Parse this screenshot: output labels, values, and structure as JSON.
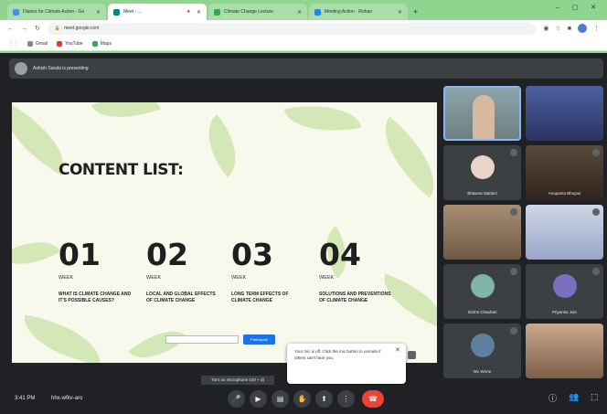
{
  "browser": {
    "tabs": [
      {
        "label": "Diaries for Climate Action - Go",
        "active": false
      },
      {
        "label": "Meet - ...",
        "active": true
      },
      {
        "label": "Climate Change Lecture",
        "active": false
      },
      {
        "label": "Meeting Action · Rohan",
        "active": false
      }
    ],
    "new_tab": "+",
    "window_controls": "– ▢ ✕",
    "url": "meet.google.com",
    "bookmarks": [
      "Gmail",
      "YouTube",
      "Maps"
    ]
  },
  "presenter_bar": {
    "text": "Ashish Sarala is presenting"
  },
  "slide": {
    "title": "CONTENT LIST:",
    "weeks": [
      {
        "num": "01",
        "label": "WEEK",
        "desc": "WHAT IS CLIMATE CHANGE AND IT'S POSSIBLE CAUSES?"
      },
      {
        "num": "02",
        "label": "WEEK",
        "desc": "LOCAL AND GLOBAL EFFECTS OF CLIMATE CHANGE"
      },
      {
        "num": "03",
        "label": "WEEK",
        "desc": "LONG TERM EFFECTS OF CLIMATE CHANGE"
      },
      {
        "num": "04",
        "label": "WEEK",
        "desc": "SOLUTIONS AND PREVENTIONS OF CLIMATE CHANGE"
      }
    ],
    "button": "Participate"
  },
  "participants": [
    {
      "name": ""
    },
    {
      "name": ""
    },
    {
      "name": "Bhawna Saklani"
    },
    {
      "name": "Anupama Bhuyan"
    },
    {
      "name": ""
    },
    {
      "name": ""
    },
    {
      "name": "Srishti Chauhan"
    },
    {
      "name": "Priyanka Jain"
    },
    {
      "name": "Wc Wone"
    },
    {
      "name": ""
    }
  ],
  "toast": {
    "text": "Your mic is off. Click the mic button to unmute if others can't hear you.",
    "close": "✕"
  },
  "tooltip": "Turn on microphone (ctrl + d)",
  "bottom": {
    "time": "3:41 PM",
    "code": "hhx-wfkv-aro"
  },
  "colors": {
    "chrome": "#8fd48f",
    "meet_bg": "#202124",
    "end_call": "#ea4335"
  }
}
